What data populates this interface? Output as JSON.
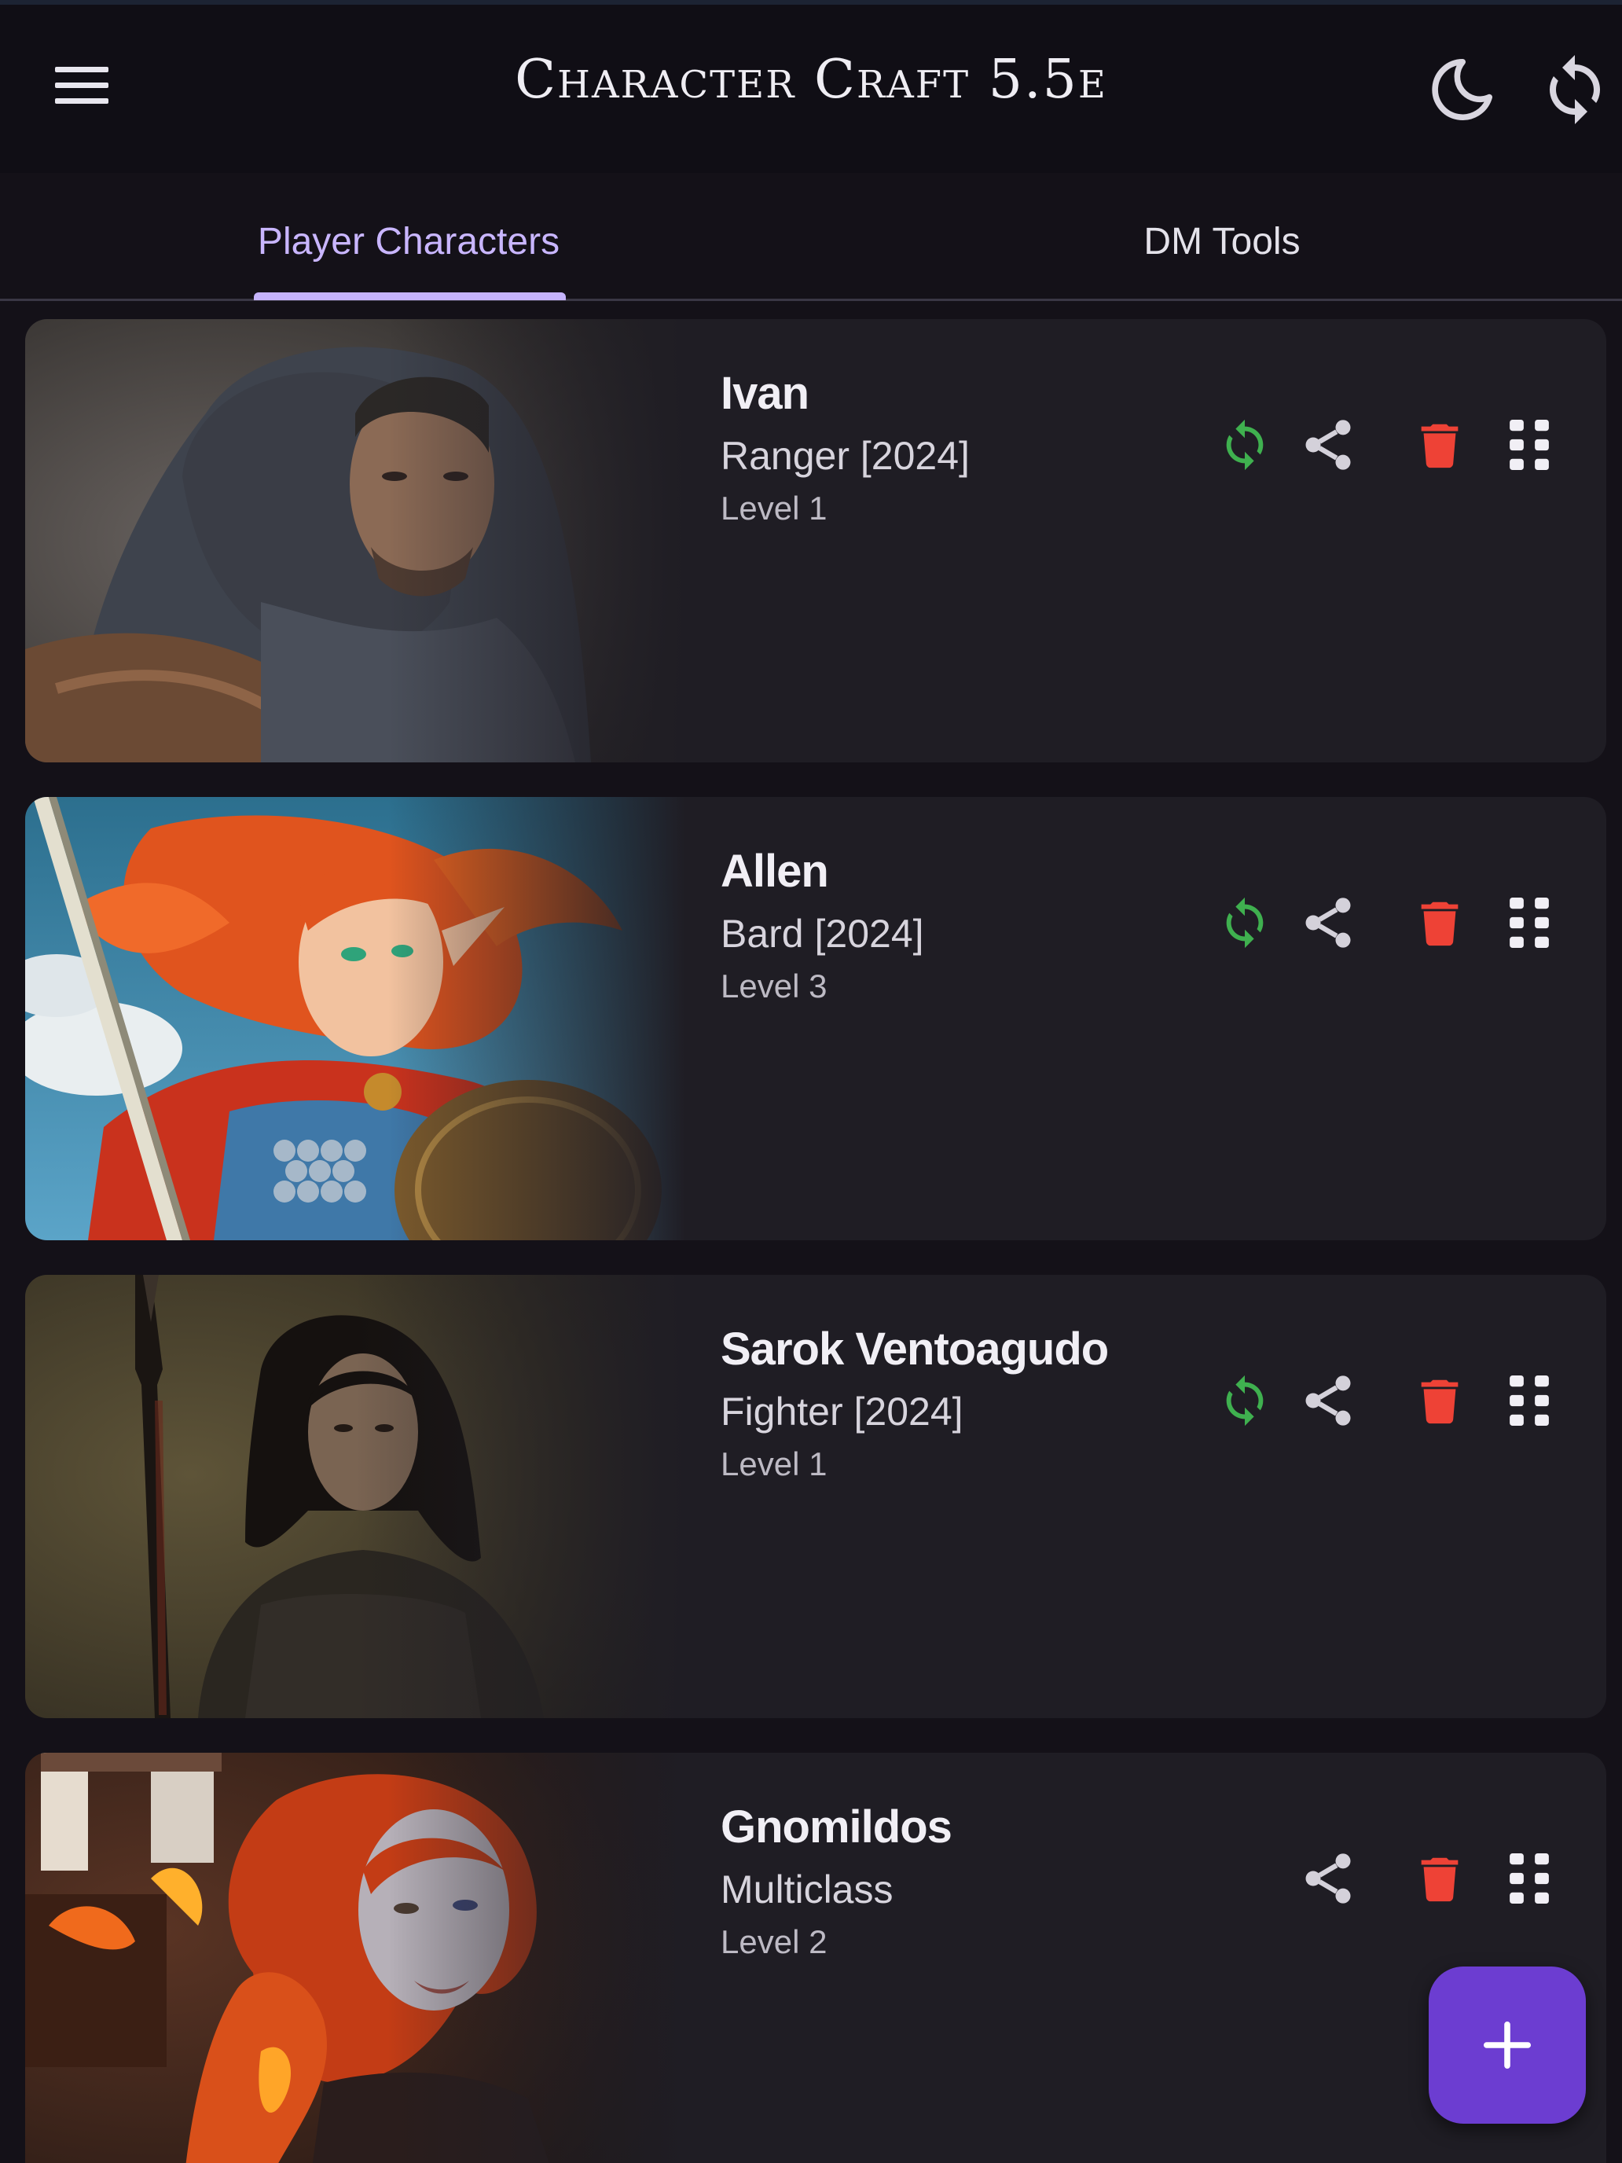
{
  "app": {
    "title": "Character Craft 5.5e",
    "accent_color": "#c9b6ff",
    "fab_color": "#6c3dd1",
    "menu_icon": "hamburger-menu-icon",
    "dark_mode_icon": "moon-icon",
    "sync_icon": "sync-icon"
  },
  "tabs": [
    {
      "label": "Player Characters",
      "selected": true
    },
    {
      "label": "DM Tools",
      "selected": false
    }
  ],
  "characters": [
    {
      "name": "Ivan",
      "class": "Ranger [2024]",
      "level": "Level 1",
      "portrait": "hooded-ranger-portrait",
      "synced": true
    },
    {
      "name": "Allen",
      "class": "Bard [2024]",
      "level": "Level 3",
      "portrait": "red-haired-elf-portrait",
      "synced": true
    },
    {
      "name": "Sarok Ventoagudo",
      "class": "Fighter [2024]",
      "level": "Level 1",
      "portrait": "dark-haired-spear-warrior-portrait",
      "synced": true
    },
    {
      "name": "Gnomildos",
      "class": "Multiclass",
      "level": "Level 2",
      "portrait": "fiery-haired-woman-portrait",
      "synced": false
    }
  ],
  "actions": {
    "sync_icon": "sync-icon",
    "share_icon": "share-icon",
    "delete_icon": "trash-icon",
    "drag_icon": "drag-handle-icon",
    "sync_color": "#3fb04f",
    "delete_color": "#ee4236"
  },
  "fab": {
    "label": "+",
    "icon": "plus-icon"
  }
}
